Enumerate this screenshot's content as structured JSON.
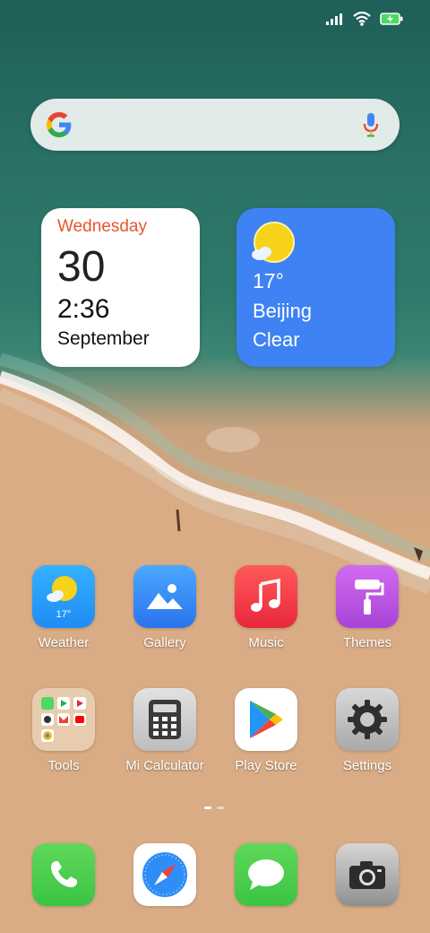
{
  "status_bar": {
    "icons": [
      "signal-icon",
      "wifi-icon",
      "battery-charging-icon"
    ]
  },
  "search": {
    "icons": [
      "google-g-icon",
      "microphone-icon"
    ]
  },
  "date_widget": {
    "day": "Wednesday",
    "date": "30",
    "time": "2:36",
    "month": "September"
  },
  "weather_widget": {
    "temperature": "17°",
    "city": "Beijing",
    "condition": "Clear"
  },
  "apps": [
    {
      "label": "Weather",
      "icon_temp": "17°"
    },
    {
      "label": "Gallery"
    },
    {
      "label": "Music"
    },
    {
      "label": "Themes"
    },
    {
      "label": "Tools"
    },
    {
      "label": "Mi Calculator"
    },
    {
      "label": "Play Store"
    },
    {
      "label": "Settings"
    }
  ],
  "dock": [
    "phone-icon",
    "browser-compass-icon",
    "messages-icon",
    "camera-icon"
  ],
  "page_indicator": {
    "pages": 2,
    "current": 1
  },
  "colors": {
    "accent_day": "#e8552a",
    "weather_widget_bg": "#3e82f3"
  }
}
